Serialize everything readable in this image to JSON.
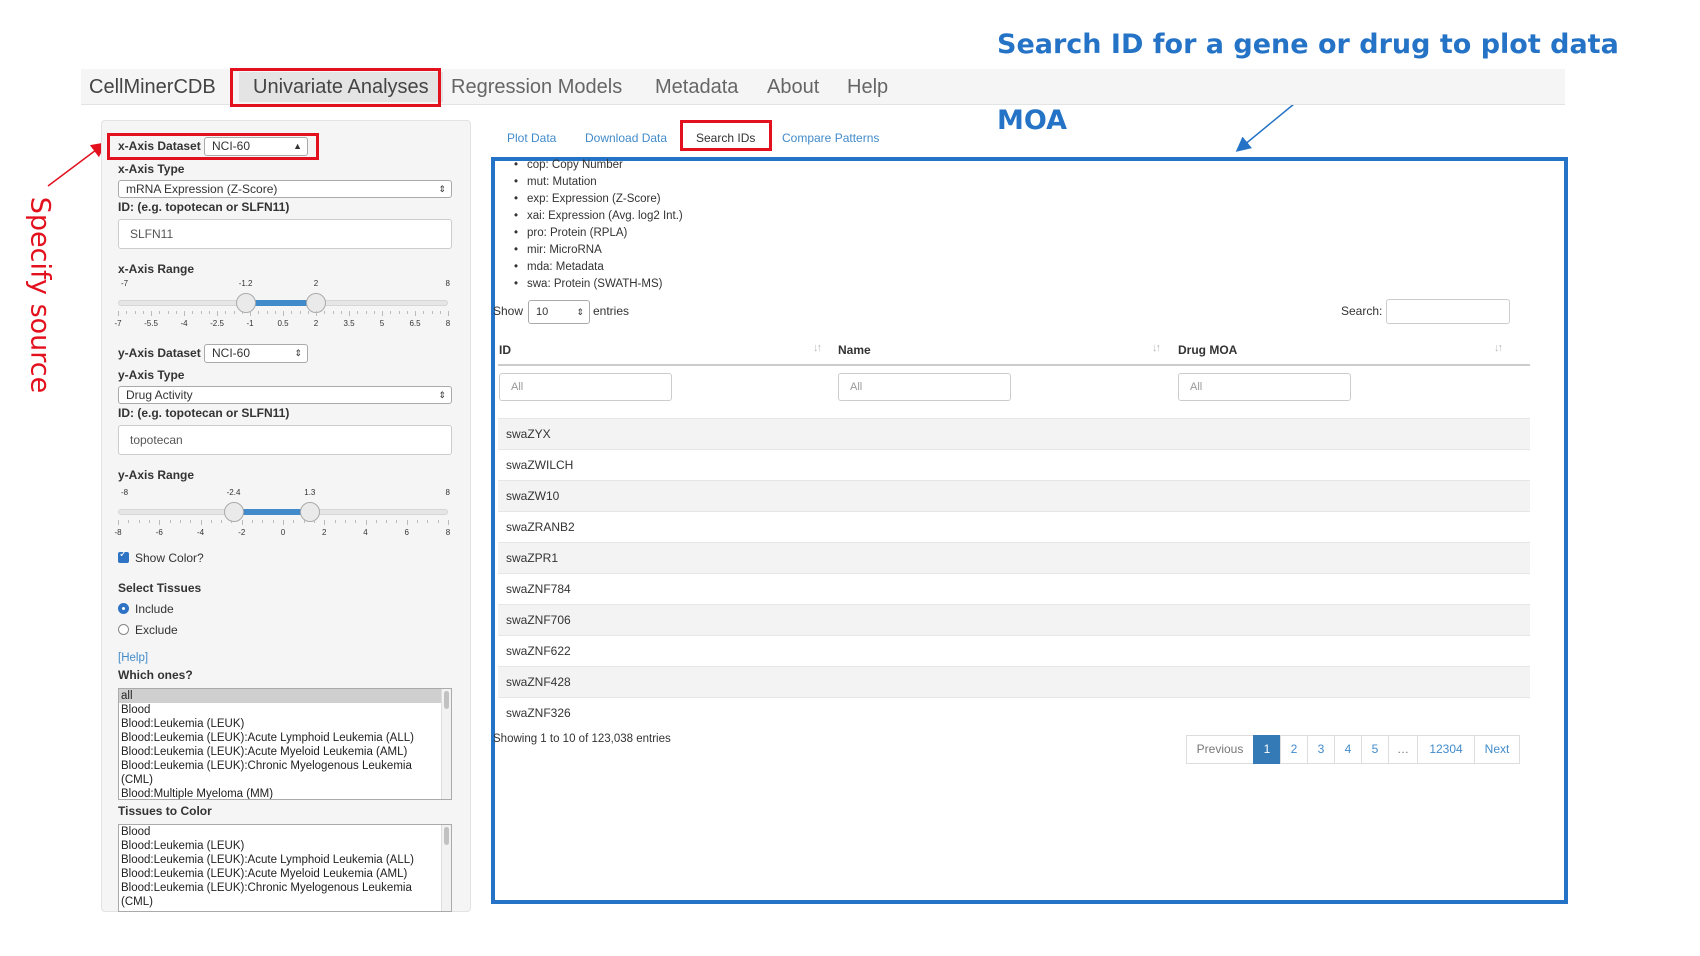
{
  "annotations": {
    "search_title": "Search ID for a gene or drug to plot data by entering data type, name or drug MOA",
    "specify_source": "Specify source"
  },
  "navbar": {
    "brand": "CellMinerCDB",
    "items": [
      "Univariate Analyses",
      "Regression Models",
      "Metadata",
      "About",
      "Help"
    ],
    "active": "Univariate Analyses"
  },
  "sidebar": {
    "x_dataset_label": "x-Axis Dataset",
    "x_dataset_value": "NCI-60",
    "x_type_label": "x-Axis Type",
    "x_type_value": "mRNA Expression (Z-Score)",
    "x_id_label": "ID: (e.g. topotecan or SLFN11)",
    "x_id_value": "SLFN11",
    "x_range_label": "x-Axis Range",
    "x_range": {
      "min_label": "-7",
      "max_label": "8",
      "low": "-1.2",
      "high": "2",
      "min": -7,
      "max": 8,
      "low_value": -1.2,
      "high_value": 2,
      "ticks": [
        "-7",
        "-5.5",
        "-4",
        "-2.5",
        "-1",
        "0.5",
        "2",
        "3.5",
        "5",
        "6.5",
        "8"
      ]
    },
    "y_dataset_label": "y-Axis Dataset",
    "y_dataset_value": "NCI-60",
    "y_type_label": "y-Axis Type",
    "y_type_value": "Drug Activity",
    "y_id_label": "ID: (e.g. topotecan or SLFN11)",
    "y_id_value": "topotecan",
    "y_range_label": "y-Axis Range",
    "y_range": {
      "min_label": "-8",
      "max_label": "8",
      "low": "-2.4",
      "high": "1.3",
      "min": -8,
      "max": 8,
      "low_value": -2.4,
      "high_value": 1.3,
      "ticks": [
        "-8",
        "-6",
        "-4",
        "-2",
        "0",
        "2",
        "4",
        "6",
        "8"
      ]
    },
    "show_color_label": "Show Color?",
    "show_color_checked": true,
    "select_tissues_label": "Select Tissues",
    "include_label": "Include",
    "exclude_label": "Exclude",
    "selected_mode": "Include",
    "help_link": "[Help]",
    "which_ones_label": "Which ones?",
    "which_ones": [
      "all",
      "Blood",
      "Blood:Leukemia (LEUK)",
      "Blood:Leukemia (LEUK):Acute Lymphoid Leukemia (ALL)",
      "Blood:Leukemia (LEUK):Acute Myeloid Leukemia (AML)",
      "Blood:Leukemia (LEUK):Chronic Myelogenous Leukemia",
      "(CML)",
      "Blood:Multiple Myeloma (MM)"
    ],
    "which_ones_selected": "all",
    "tissues_color_label": "Tissues to Color",
    "tissues_color": [
      "Blood",
      "Blood:Leukemia (LEUK)",
      "Blood:Leukemia (LEUK):Acute Lymphoid Leukemia (ALL)",
      "Blood:Leukemia (LEUK):Acute Myeloid Leukemia (AML)",
      "Blood:Leukemia (LEUK):Chronic Myelogenous Leukemia",
      "(CML)"
    ]
  },
  "tabs": [
    "Plot Data",
    "Download Data",
    "Search IDs",
    "Compare Patterns"
  ],
  "active_tab": "Search IDs",
  "main": {
    "data_types": [
      "cop: Copy Number",
      "mut: Mutation",
      "exp: Expression (Z-Score)",
      "xai: Expression (Avg. log2 Int.)",
      "pro: Protein (RPLA)",
      "mir: MicroRNA",
      "mda: Metadata",
      "swa: Protein (SWATH-MS)"
    ],
    "show_label": "Show",
    "entries_value": "10",
    "entries_label": "entries",
    "search_label": "Search:",
    "search_value": "",
    "columns": [
      "ID",
      "Name",
      "Drug MOA"
    ],
    "filter_placeholder": "All",
    "rows": [
      {
        "id": "swaZYX",
        "name": "",
        "moa": ""
      },
      {
        "id": "swaZWILCH",
        "name": "",
        "moa": ""
      },
      {
        "id": "swaZW10",
        "name": "",
        "moa": ""
      },
      {
        "id": "swaZRANB2",
        "name": "",
        "moa": ""
      },
      {
        "id": "swaZPR1",
        "name": "",
        "moa": ""
      },
      {
        "id": "swaZNF784",
        "name": "",
        "moa": ""
      },
      {
        "id": "swaZNF706",
        "name": "",
        "moa": ""
      },
      {
        "id": "swaZNF622",
        "name": "",
        "moa": ""
      },
      {
        "id": "swaZNF428",
        "name": "",
        "moa": ""
      },
      {
        "id": "swaZNF326",
        "name": "",
        "moa": ""
      }
    ],
    "info": "Showing 1 to 10 of 123,038 entries",
    "pagination": [
      "Previous",
      "1",
      "2",
      "3",
      "4",
      "5",
      "…",
      "12304",
      "Next"
    ],
    "current_page": "1"
  },
  "colors": {
    "annotation_blue": "#2573c6",
    "annotation_red": "#e3111e",
    "link_blue": "#428bca",
    "active_page": "#337ab7"
  }
}
